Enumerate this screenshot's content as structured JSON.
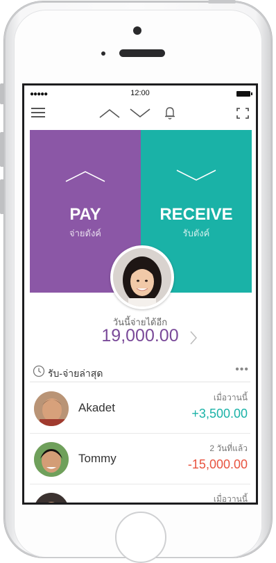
{
  "status": {
    "signal": "●●●●●",
    "time": "12:00"
  },
  "navbar": {
    "menu_icon": "hamburger-icon",
    "up_icon": "chevron-up-icon",
    "down_icon": "chevron-down-icon",
    "bell_icon": "bell-icon",
    "expand_icon": "expand-icon"
  },
  "hero": {
    "pay": {
      "label": "PAY",
      "sublabel": "จ่ายตังค์",
      "color": "#8b57a6"
    },
    "receive": {
      "label": "RECEIVE",
      "sublabel": "รับตังค์",
      "color": "#1ab2a7"
    }
  },
  "limit": {
    "caption": "วันนี้จ่ายได้อีก",
    "amount": "19,000.00"
  },
  "recent": {
    "title": "รับ-จ่ายล่าสุด",
    "more": "•••",
    "items": [
      {
        "name": "Akadet",
        "time": "เมื่อวานนี้",
        "amount": "+3,500.00",
        "color": "#1ab2a7"
      },
      {
        "name": "Tommy",
        "time": "2 วันที่แล้ว",
        "amount": "-15,000.00",
        "color": "#e8533f"
      },
      {
        "name": "",
        "time": "เมื่อวานนี้",
        "amount": "",
        "color": "#333333"
      }
    ]
  }
}
